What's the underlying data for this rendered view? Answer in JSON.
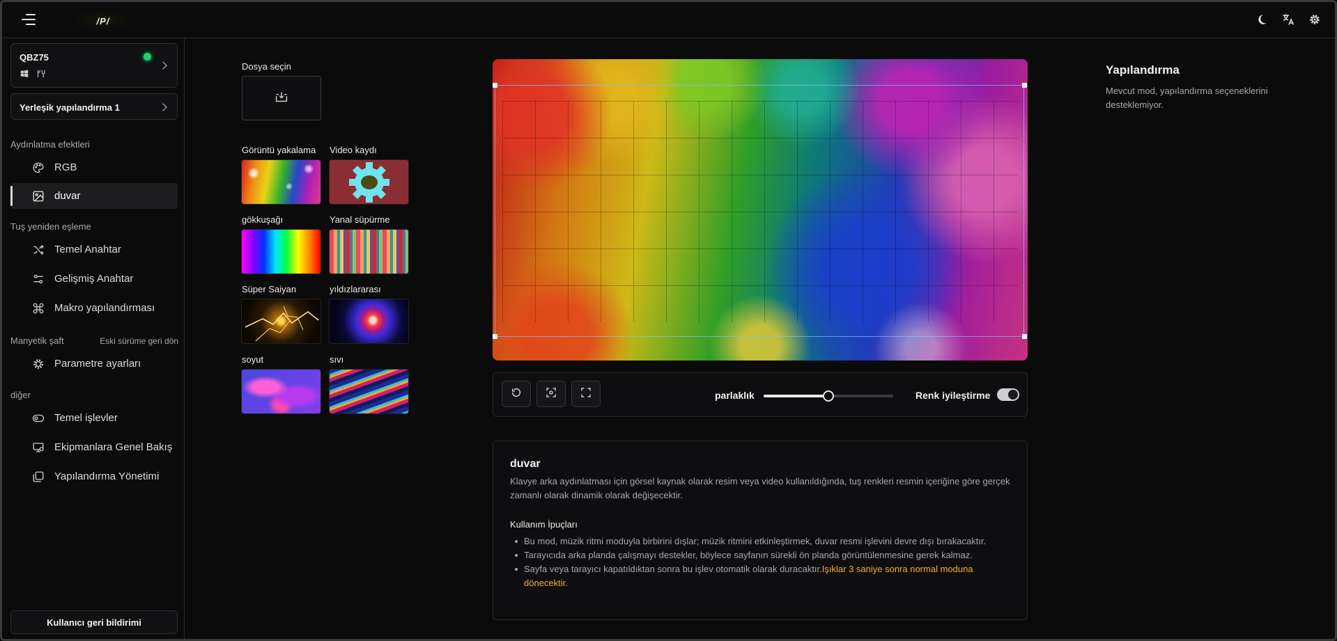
{
  "app": {
    "logo_text": "/P/"
  },
  "device": {
    "name": "QBZ75",
    "status_color": "#1fd06b"
  },
  "config_selector": {
    "label": "Yerleşik yapılandırma 1"
  },
  "sidebar": {
    "sections": [
      {
        "title": "Aydınlatma efektleri",
        "items": [
          {
            "label": "RGB",
            "icon": "palette-icon"
          },
          {
            "label": "duvar",
            "icon": "image-icon",
            "active": true
          }
        ]
      },
      {
        "title": "Tuş yeniden eşleme",
        "items": [
          {
            "label": "Temel Anahtar",
            "icon": "shuffle-icon"
          },
          {
            "label": "Gelişmiş Anahtar",
            "icon": "sliders-icon"
          },
          {
            "label": "Makro yapılandırması",
            "icon": "command-icon"
          }
        ]
      },
      {
        "title": "Manyetik şaft",
        "aside": "Eski sürüme geri dön",
        "items": [
          {
            "label": "Parametre ayarları",
            "icon": "gear-icon"
          }
        ]
      },
      {
        "title": "diğer",
        "items": [
          {
            "label": "Temel işlevler",
            "icon": "toggle-icon"
          },
          {
            "label": "Ekipmanlara Genel Bakış",
            "icon": "monitor-icon"
          },
          {
            "label": "Yapılandırma Yönetimi",
            "icon": "files-icon"
          }
        ]
      }
    ],
    "feedback_label": "Kullanıcı geri bildirimi"
  },
  "source": {
    "file_label": "Dosya seçin",
    "presets": [
      {
        "label": "Görüntü yakalama",
        "style": "glitter"
      },
      {
        "label": "Video kaydı",
        "style": "gear"
      },
      {
        "label": "gökkuşağı",
        "style": "rainbow"
      },
      {
        "label": "Yanal süpürme",
        "style": "stripes"
      },
      {
        "label": "Süper Saiyan",
        "style": "lightning"
      },
      {
        "label": "yıldızlararası",
        "style": "vortex"
      },
      {
        "label": "soyut",
        "style": "abstract"
      },
      {
        "label": "sıvı",
        "style": "liquid"
      }
    ]
  },
  "controls": {
    "brightness_label": "parlaklık",
    "brightness_value": 0.5,
    "enhance_label": "Renk iyileştirme",
    "enhance_on": true
  },
  "info": {
    "title": "duvar",
    "description": "Klavye arka aydınlatması için görsel kaynak olarak resim veya video kullanıldığında, tuş renkleri resmin içeriğine göre gerçek zamanlı olarak dinamik olarak değişecektir.",
    "tips_title": "Kullanım İpuçları",
    "tips": [
      "Bu mod, müzik ritmi moduyla birbirini dışlar; müzik ritmini etkinleştirmek, duvar resmi işlevini devre dışı bırakacaktır.",
      "Tarayıcıda arka planda çalışmayı destekler, böylece sayfanın sürekli ön planda görüntülenmesine gerek kalmaz."
    ],
    "tip3_text": "Sayfa veya tarayıcı kapatıldıktan sonra bu işlev otomatik olarak duracaktır.",
    "tip3_warning": "Işıklar 3 saniye sonra normal moduna dönecektir."
  },
  "right_panel": {
    "title": "Yapılandırma",
    "description": "Mevcut mod, yapılandırma seçeneklerini desteklemiyor."
  },
  "colors": {
    "warning": "#f3b12f",
    "accent": "#e8e8e8"
  }
}
